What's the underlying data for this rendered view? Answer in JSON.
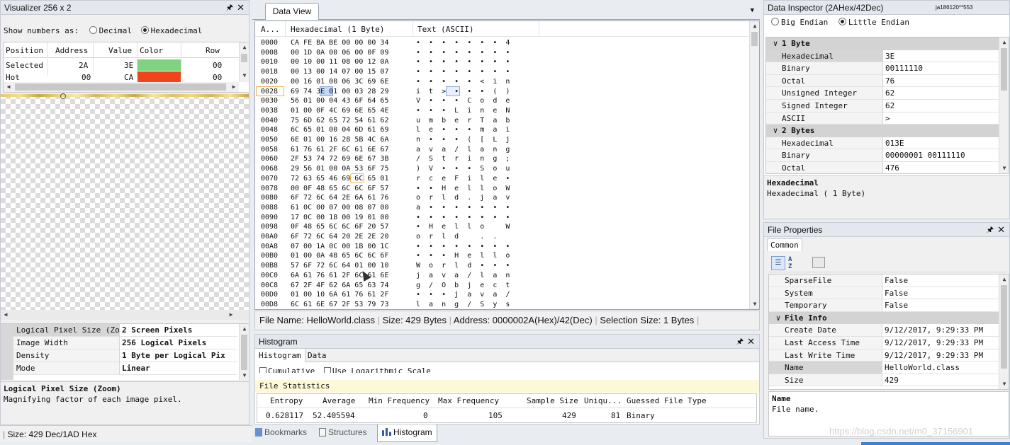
{
  "visualizer": {
    "title": "Visualizer 256 x 2",
    "show_label": "Show numbers as:",
    "opt_decimal": "Decimal",
    "opt_hex": "Hexadecimal",
    "columns": [
      "Position",
      "Address",
      "Value",
      "Color",
      "Row"
    ],
    "rows": [
      {
        "position": "Selected",
        "address": "2A",
        "value": "3E",
        "color": "#7fd27f",
        "row": "00"
      },
      {
        "position": "Hot",
        "address": "00",
        "value": "CA",
        "color": "#f0441a",
        "row": "00"
      }
    ],
    "props": [
      {
        "key": "Logical Pixel Size (Zoo",
        "value": "2 Screen Pixels"
      },
      {
        "key": "Image Width",
        "value": "256 Logical Pixels"
      },
      {
        "key": "Density",
        "value": "1 Byte per Logical Pix"
      },
      {
        "key": "Mode",
        "value": "Linear"
      }
    ],
    "desc_title": "Logical Pixel Size (Zoom)",
    "desc_text": "Magnifying factor of each image pixel."
  },
  "data_view": {
    "tab": "Data View",
    "col_addr": "A...",
    "col_hex": "Hexadecimal (1 Byte)",
    "col_text": "Text (ASCII)",
    "rows": [
      {
        "a": "0000",
        "h": "CA FE BA BE 00 00 00 34",
        "t": "•  •  •  •  •  •  •  4"
      },
      {
        "a": "0008",
        "h": "00 1D 0A 00 06 00 0F 09",
        "t": "•  •  •  •  •  •  •  •"
      },
      {
        "a": "0010",
        "h": "00 10 00 11 08 00 12 0A",
        "t": "•  •  •  •  •  •  •  •"
      },
      {
        "a": "0018",
        "h": "00 13 00 14 07 00 15 07",
        "t": "•  •  •  •  •  •  •  •"
      },
      {
        "a": "0020",
        "h": "00 16 01 00 06 3C 69 6E",
        "t": "•  •  •  •  •  <  i  n"
      },
      {
        "a": "0028",
        "h": "69 74 3E 01 00 03 28 29",
        "t": "i  t  >  •  •  •  (  )"
      },
      {
        "a": "0030",
        "h": "56 01 00 04 43 6F 64 65",
        "t": "V  •  •  •  C  o  d  e"
      },
      {
        "a": "0038",
        "h": "01 00 0F 4C 69 6E 65 4E",
        "t": "•  •  •  L  i  n  e  N"
      },
      {
        "a": "0040",
        "h": "75 6D 62 65 72 54 61 62",
        "t": "u  m  b  e  r  T  a  b"
      },
      {
        "a": "0048",
        "h": "6C 65 01 00 04 6D 61 69",
        "t": "l  e  •  •  •  m  a  i"
      },
      {
        "a": "0050",
        "h": "6E 01 00 16 28 5B 4C 6A",
        "t": "n  •  •  •  (  [  L  j"
      },
      {
        "a": "0058",
        "h": "61 76 61 2F 6C 61 6E 67",
        "t": "a  v  a  /  l  a  n  g"
      },
      {
        "a": "0060",
        "h": "2F 53 74 72 69 6E 67 3B",
        "t": "/  S  t  r  i  n  g  ;"
      },
      {
        "a": "0068",
        "h": "29 56 01 00 0A 53 6F 75",
        "t": ")  V  •  •  •  S  o  u"
      },
      {
        "a": "0070",
        "h": "72 63 65 46 69 6C 65 01",
        "t": "r  c  e  F  i  l  e  •"
      },
      {
        "a": "0078",
        "h": "00 0F 48 65 6C 6C 6F 57",
        "t": "•  •  H  e  l  l  o  W"
      },
      {
        "a": "0080",
        "h": "6F 72 6C 64 2E 6A 61 76",
        "t": "o  r  l  d  .  j  a  v"
      },
      {
        "a": "0088",
        "h": "61 0C 00 07 00 08 07 00",
        "t": "a  •  •  •  •  •  •  •"
      },
      {
        "a": "0090",
        "h": "17 0C 00 18 00 19 01 00",
        "t": "•  •  •  •  •  •  •  •"
      },
      {
        "a": "0098",
        "h": "0F 48 65 6C 6C 6F 20 57",
        "t": "•  H  e  l  l  o     W"
      },
      {
        "a": "00A0",
        "h": "6F 72 6C 64 20 2E 2E 20",
        "t": "o  r  l  d     .  .   "
      },
      {
        "a": "00A8",
        "h": "07 00 1A 0C 00 1B 00 1C",
        "t": "•  •  •  •  •  •  •  •"
      },
      {
        "a": "00B0",
        "h": "01 00 0A 48 65 6C 6C 6F",
        "t": "•  •  •  H  e  l  l  o"
      },
      {
        "a": "00B8",
        "h": "57 6F 72 6C 64 01 00 10",
        "t": "W  o  r  l  d  •  •  •"
      },
      {
        "a": "00C0",
        "h": "6A 61 76 61 2F 6C 61 6E",
        "t": "j  a  v  a  /  l  a  n"
      },
      {
        "a": "00C8",
        "h": "67 2F 4F 62 6A 65 63 74",
        "t": "g  /  O  b  j  e  c  t"
      },
      {
        "a": "00D0",
        "h": "01 00 10 6A 61 76 61 2F",
        "t": "•  •  •  j  a  v  a  /"
      },
      {
        "a": "00D8",
        "h": "6C 61 6E 67 2F 53 79 73",
        "t": "l  a  n  g  /  S  y  s"
      }
    ],
    "status": {
      "file_name": "File Name: HelloWorld.class",
      "size": "Size: 429 Bytes",
      "address": "Address: 0000002A(Hex)/42(Dec)",
      "selection": "Selection Size: 1 Bytes"
    }
  },
  "histogram": {
    "title": "Histogram",
    "tabs": [
      "Histogram",
      "Data"
    ],
    "check_cumulative": "Cumulative",
    "check_log": "Use Logarithmic Scale",
    "stats_title": "File Statistics",
    "stats_headers": [
      "Entropy",
      "Average",
      "Min Frequency",
      "Max Frequency",
      "Sample Size",
      "Uniqu...",
      "Guessed File Type"
    ],
    "stats_values": [
      "0.628117",
      "52.405594",
      "0",
      "105",
      "429",
      "81",
      "Binary"
    ]
  },
  "bottom_tabs": [
    "Bookmarks",
    "Structures",
    "Histogram"
  ],
  "left_status": "Size: 429 Dec/1AD Hex",
  "inspector": {
    "title": "Data Inspector (2AHex/42Dec)",
    "corner": "ja186120**553",
    "opt_big": "Big Endian",
    "opt_little": "Little Endian",
    "cat1": "1 Byte",
    "rows1": [
      {
        "k": "Hexadecimal",
        "v": "3E"
      },
      {
        "k": "Binary",
        "v": "00111110"
      },
      {
        "k": "Octal",
        "v": "76"
      },
      {
        "k": "Unsigned Integer",
        "v": "62"
      },
      {
        "k": "Signed Integer",
        "v": "62"
      },
      {
        "k": "ASCII",
        "v": ">"
      }
    ],
    "cat2": "2 Bytes",
    "rows2": [
      {
        "k": "Hexadecimal",
        "v": "013E"
      },
      {
        "k": "Binary",
        "v": "00000001 00111110"
      },
      {
        "k": "Octal",
        "v": "476"
      }
    ],
    "desc_title": "Hexadecimal",
    "desc_text": "Hexadecimal ( 1 Byte)"
  },
  "file_props": {
    "title": "File Properties",
    "tab": "Common",
    "rows_a": [
      {
        "k": "SparseFile",
        "v": "False"
      },
      {
        "k": "System",
        "v": "False"
      },
      {
        "k": "Temporary",
        "v": "False"
      }
    ],
    "cat": "File Info",
    "rows_b": [
      {
        "k": "Create Date",
        "v": "9/12/2017, 9:29:33 PM"
      },
      {
        "k": "Last Access Time",
        "v": "9/12/2017, 9:29:33 PM"
      },
      {
        "k": "Last Write Time",
        "v": "9/12/2017, 9:29:33 PM"
      },
      {
        "k": "Name",
        "v": "HelloWorld.class"
      },
      {
        "k": "Size",
        "v": "429"
      }
    ],
    "desc_title": "Name",
    "desc_text": "File name."
  },
  "watermark": "https://blog.csdn.net/m0_37156901"
}
